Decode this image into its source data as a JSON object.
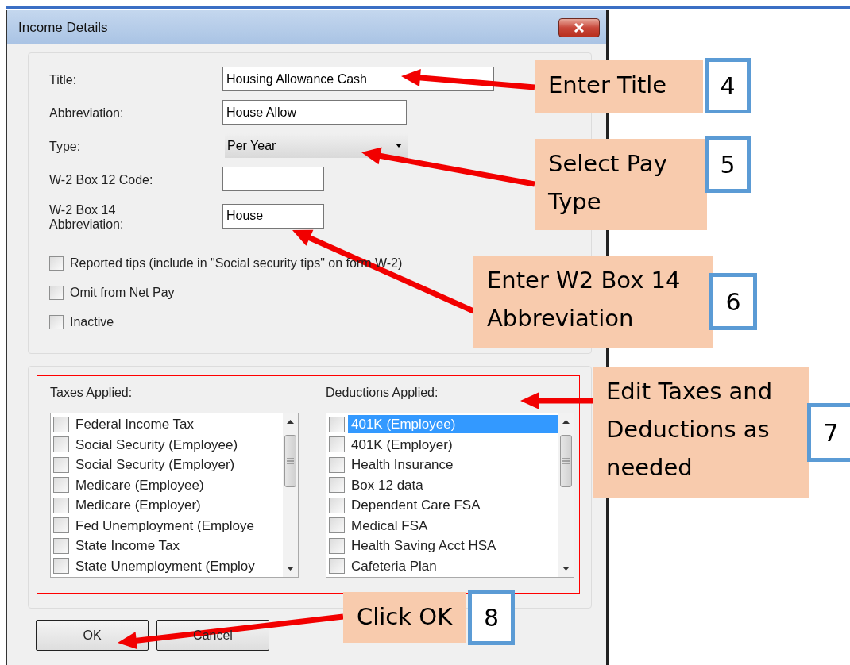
{
  "window": {
    "title": "Income Details"
  },
  "fields": [
    {
      "label": "Title:",
      "kind": "text",
      "value": "Housing Allowance Cash"
    },
    {
      "label": "Abbreviation:",
      "kind": "text",
      "value": "House Allow"
    },
    {
      "label": "Type:",
      "kind": "dropdown",
      "value": "Per Year"
    },
    {
      "label": "W-2 Box 12 Code:",
      "kind": "text"
    },
    {
      "label": "W-2 Box 14 Abbreviation:",
      "kind": "text",
      "value": "House"
    }
  ],
  "options": [
    {
      "label": "Reported tips (include in \"Social security tips\" on form W-2)",
      "checked": false
    },
    {
      "label": "Omit from Net Pay",
      "checked": false
    },
    {
      "label": "Inactive",
      "checked": false
    }
  ],
  "lists": [
    {
      "label": "Taxes Applied:",
      "items": [
        {
          "label": "Federal Income Tax",
          "checked": false,
          "selected": false
        },
        {
          "label": "Social Security (Employee)",
          "checked": false,
          "selected": false
        },
        {
          "label": "Social Security (Employer)",
          "checked": false,
          "selected": false
        },
        {
          "label": "Medicare (Employee)",
          "checked": false,
          "selected": false
        },
        {
          "label": "Medicare (Employer)",
          "checked": false,
          "selected": false
        },
        {
          "label": "Fed Unemployment (Employe",
          "checked": false,
          "selected": false
        },
        {
          "label": "State Income Tax",
          "checked": false,
          "selected": false
        },
        {
          "label": "State Unemployment (Employ",
          "checked": false,
          "selected": false
        }
      ]
    },
    {
      "label": "Deductions Applied:",
      "items": [
        {
          "label": "401K (Employee)",
          "checked": false,
          "selected": true
        },
        {
          "label": "401K (Employer)",
          "checked": false,
          "selected": false
        },
        {
          "label": "Health Insurance",
          "checked": false,
          "selected": false
        },
        {
          "label": "Box 12 data",
          "checked": false,
          "selected": false
        },
        {
          "label": "Dependent Care FSA",
          "checked": false,
          "selected": false
        },
        {
          "label": "Medical FSA",
          "checked": false,
          "selected": false
        },
        {
          "label": "Health Saving Acct HSA",
          "checked": false,
          "selected": false
        },
        {
          "label": "Cafeteria Plan",
          "checked": false,
          "selected": false
        }
      ]
    }
  ],
  "buttons": [
    "OK",
    "Cancel"
  ],
  "callouts": [
    {
      "text": "Enter Title",
      "number": "4"
    },
    {
      "text": "Select Pay Type",
      "number": "5"
    },
    {
      "text": "Enter W2 Box 14 Abbreviation",
      "number": "6"
    },
    {
      "text": "Edit Taxes and Deductions as needed",
      "number": "7"
    },
    {
      "text": "Click OK",
      "number": "8"
    }
  ]
}
